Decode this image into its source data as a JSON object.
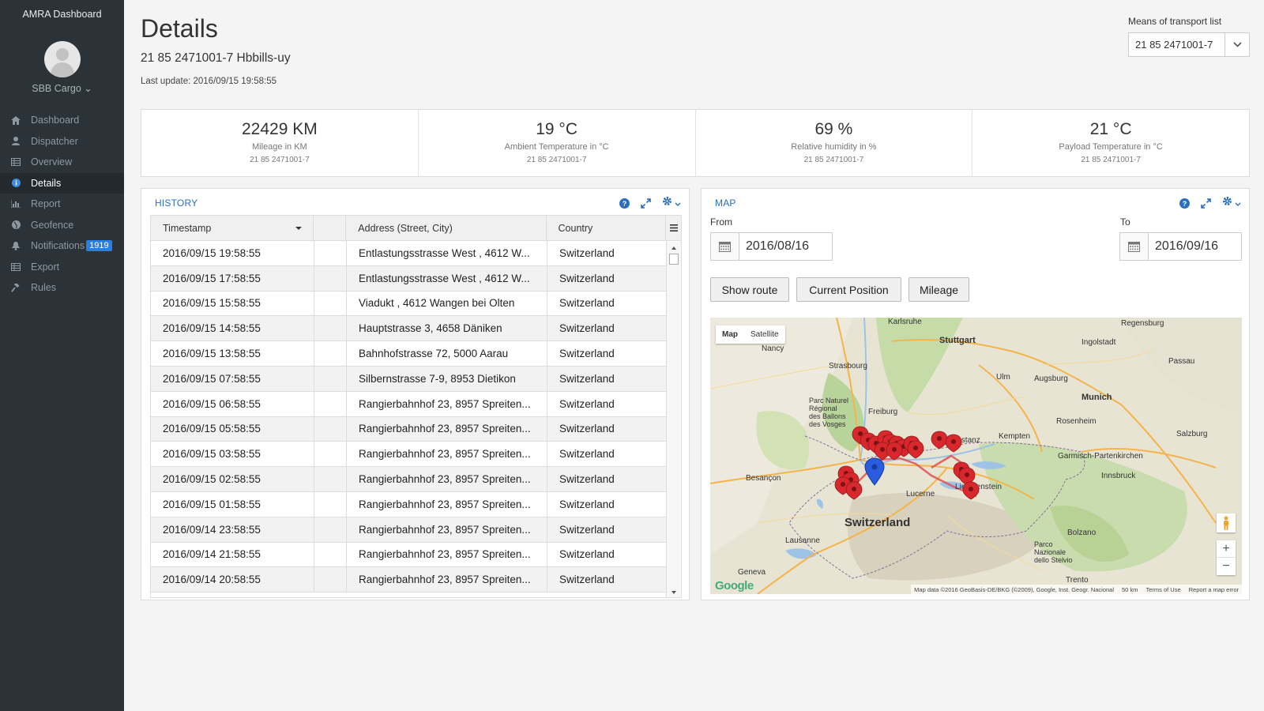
{
  "app": {
    "title": "AMRA Dashboard"
  },
  "user": {
    "name": "SBB Cargo ⌄"
  },
  "nav": [
    {
      "label": "Dashboard",
      "icon": "home-icon"
    },
    {
      "label": "Dispatcher",
      "icon": "user-icon"
    },
    {
      "label": "Overview",
      "icon": "table-icon"
    },
    {
      "label": "Details",
      "icon": "info-icon",
      "active": true
    },
    {
      "label": "Report",
      "icon": "bar-chart-icon"
    },
    {
      "label": "Geofence",
      "icon": "globe-icon"
    },
    {
      "label": "Notifications",
      "icon": "bell-icon",
      "badge": "1919"
    },
    {
      "label": "Export",
      "icon": "table-icon"
    },
    {
      "label": "Rules",
      "icon": "gavel-icon"
    }
  ],
  "header": {
    "title": "Details",
    "subtitle": "21 85 2471001-7 Hbbills-uy",
    "last_update": "Last update: 2016/09/15 19:58:55",
    "transport_label": "Means of transport list",
    "transport_value": "21 85 2471001-7"
  },
  "stats": [
    {
      "value": "22429 KM",
      "label": "Mileage in KM",
      "id": "21 85 2471001-7"
    },
    {
      "value": "19 °C",
      "label": "Ambient Temperature in °C",
      "id": "21 85 2471001-7"
    },
    {
      "value": "69 %",
      "label": "Relative humidity in %",
      "id": "21 85 2471001-7"
    },
    {
      "value": "21 °C",
      "label": "Payload Temperature in °C",
      "id": "21 85 2471001-7"
    }
  ],
  "history": {
    "title": "HISTORY",
    "columns": [
      "Timestamp",
      "",
      "Address (Street, City)",
      "Country"
    ],
    "rows": [
      [
        "2016/09/15 19:58:55",
        "Entlastungsstrasse West , 4612 W...",
        "Switzerland"
      ],
      [
        "2016/09/15 17:58:55",
        "Entlastungsstrasse West , 4612 W...",
        "Switzerland"
      ],
      [
        "2016/09/15 15:58:55",
        "Viadukt , 4612 Wangen bei Olten",
        "Switzerland"
      ],
      [
        "2016/09/15 14:58:55",
        "Hauptstrasse 3, 4658 Däniken",
        "Switzerland"
      ],
      [
        "2016/09/15 13:58:55",
        "Bahnhofstrasse 72, 5000 Aarau",
        "Switzerland"
      ],
      [
        "2016/09/15 07:58:55",
        "Silbernstrasse 7-9, 8953 Dietikon",
        "Switzerland"
      ],
      [
        "2016/09/15 06:58:55",
        "Rangierbahnhof 23, 8957 Spreiten...",
        "Switzerland"
      ],
      [
        "2016/09/15 05:58:55",
        "Rangierbahnhof 23, 8957 Spreiten...",
        "Switzerland"
      ],
      [
        "2016/09/15 03:58:55",
        "Rangierbahnhof 23, 8957 Spreiten...",
        "Switzerland"
      ],
      [
        "2016/09/15 02:58:55",
        "Rangierbahnhof 23, 8957 Spreiten...",
        "Switzerland"
      ],
      [
        "2016/09/15 01:58:55",
        "Rangierbahnhof 23, 8957 Spreiten...",
        "Switzerland"
      ],
      [
        "2016/09/14 23:58:55",
        "Rangierbahnhof 23, 8957 Spreiten...",
        "Switzerland"
      ],
      [
        "2016/09/14 21:58:55",
        "Rangierbahnhof 23, 8957 Spreiten...",
        "Switzerland"
      ],
      [
        "2016/09/14 20:58:55",
        "Rangierbahnhof 23, 8957 Spreiten...",
        "Switzerland"
      ]
    ]
  },
  "map_panel": {
    "title": "MAP",
    "from_label": "From",
    "to_label": "To",
    "from_value": "2016/08/16",
    "to_value": "2016/09/16",
    "btn_route": "Show route",
    "btn_position": "Current Position",
    "btn_mileage": "Mileage",
    "map_type": "Map",
    "satellite": "Satellite",
    "attribution": "Map data ©2016 GeoBasis-DE/BKG (©2009), Google, Inst. Geogr. Nacional",
    "scale": "50 km",
    "terms": "Terms of Use",
    "report": "Report a map error",
    "google": "Google"
  },
  "colors": {
    "accent": "#2a6ebd",
    "sidebar": "#2b3338",
    "marker": "#d9272e",
    "route": "#e05050"
  }
}
